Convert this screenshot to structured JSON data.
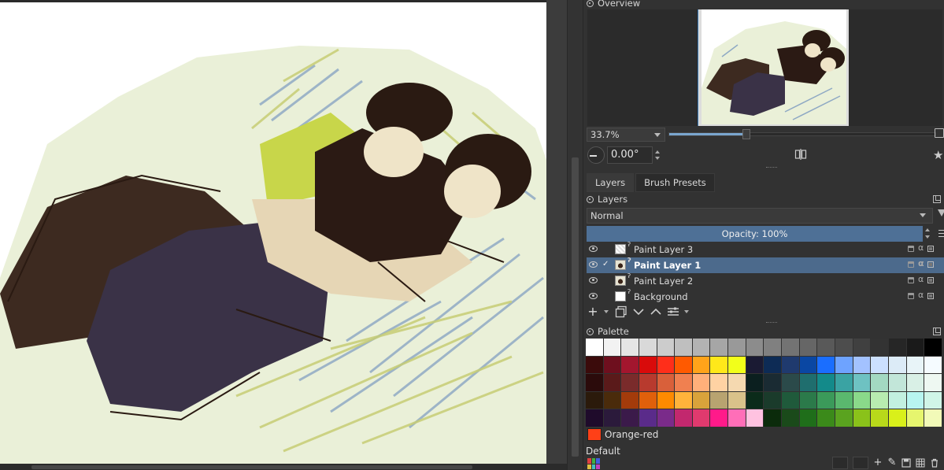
{
  "overview": {
    "title": "Overview"
  },
  "view": {
    "zoom": "33.7%",
    "rotation": "0.00°",
    "zoom_fraction": 0.29
  },
  "tabs": [
    {
      "label": "Layers",
      "active": true
    },
    {
      "label": "Brush Presets",
      "active": false
    }
  ],
  "layers_panel": {
    "title": "Layers",
    "blend_mode": "Normal",
    "opacity": "Opacity:  100%",
    "layers": [
      {
        "name": "Paint Layer 3",
        "selected": false,
        "thumb": "checker"
      },
      {
        "name": "Paint Layer 1",
        "selected": true,
        "thumb": "sketch"
      },
      {
        "name": "Paint Layer 2",
        "selected": false,
        "thumb": "sketch"
      },
      {
        "name": "Background",
        "selected": false,
        "thumb": "white"
      }
    ]
  },
  "palette": {
    "title": "Palette",
    "current_color_name": "Orange-red",
    "current_color": "#ff4017",
    "palette_name": "Default",
    "swatches": [
      "#ffffff",
      "#f2f2f2",
      "#e5e5e5",
      "#d9d9d9",
      "#cccccc",
      "#bfbfbf",
      "#b3b3b3",
      "#a6a6a6",
      "#999999",
      "#8c8c8c",
      "#808080",
      "#737373",
      "#666666",
      "#595959",
      "#4d4d4d",
      "#404040",
      "#333333",
      "#262626",
      "#1a1a1a",
      "#000000",
      "#3b0b0b",
      "#6e0f1e",
      "#a3162e",
      "#d90b0b",
      "#ff2e1a",
      "#ff5a00",
      "#ffa31a",
      "#ffe81a",
      "#f2ff1a",
      "#1a1a33",
      "#0d2b55",
      "#1f3a6e",
      "#0a47a3",
      "#1a6eff",
      "#6ea3ff",
      "#a3c2ff",
      "#cce0ff",
      "#dcebf7",
      "#e8f4f8",
      "#f5fbff",
      "#2b0b0b",
      "#5a1a1a",
      "#7a2b2b",
      "#b83a2e",
      "#d9603a",
      "#f08050",
      "#ffb07a",
      "#ffd2a3",
      "#f5d9b0",
      "#0b1f1f",
      "#1a2b33",
      "#2b4a4a",
      "#1f6e6e",
      "#138a8a",
      "#3aa3a3",
      "#6ec2c2",
      "#a3d9c2",
      "#c2e6d9",
      "#d9f0e6",
      "#eef8f2",
      "#2b1a0b",
      "#4a2b0b",
      "#a33b0b",
      "#e0600b",
      "#ff8a00",
      "#ffb33b",
      "#d9a33b",
      "#b8a370",
      "#d9c28a",
      "#0b2b1a",
      "#1a3b2b",
      "#1f5a3b",
      "#2b7a4a",
      "#3b9a5a",
      "#5ab86e",
      "#8ad98a",
      "#b8ecb0",
      "#c2f0e0",
      "#b8f5f0",
      "#d0f5e8",
      "#1f0b2b",
      "#2b1a3b",
      "#3b1a4a",
      "#5a2b8a",
      "#7a2b8a",
      "#c2286e",
      "#e03a6e",
      "#ff1a8a",
      "#ff6eb8",
      "#ffc2e0",
      "#0b2b0b",
      "#1a4a1a",
      "#1f6e1a",
      "#3b8a1a",
      "#5aa31f",
      "#8ac21a",
      "#b8d91a",
      "#d9f01a",
      "#e6f56e",
      "#f2fab8"
    ]
  }
}
